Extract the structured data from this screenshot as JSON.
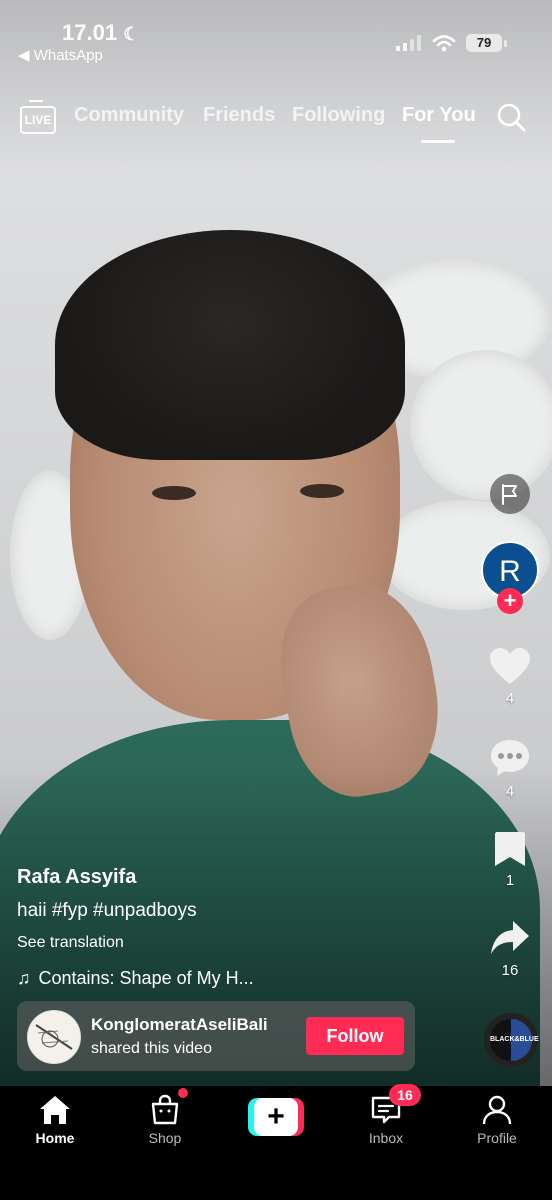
{
  "status_bar": {
    "time": "17.01",
    "back_app": "◀ WhatsApp",
    "battery": "79"
  },
  "top_nav": {
    "live_label": "LIVE",
    "tabs": [
      {
        "label": "Community",
        "active": false
      },
      {
        "label": "Friends",
        "active": false
      },
      {
        "label": "Following",
        "active": false
      },
      {
        "label": "For You",
        "active": true
      }
    ]
  },
  "right_rail": {
    "avatar_initial": "R",
    "likes": "4",
    "comments": "4",
    "saves": "1",
    "shares": "16",
    "music_disc_text": "BLACK&BLUE"
  },
  "post": {
    "username": "Rafa Assyifa",
    "caption": "haii #fyp #unpadboys",
    "see_translation": "See translation",
    "music": "Contains: Shape of My H..."
  },
  "share_card": {
    "name": "KonglomeratAseliBali",
    "subtitle": "shared this video",
    "follow_label": "Follow"
  },
  "bottom_nav": {
    "items": [
      {
        "label": "Home",
        "active": true
      },
      {
        "label": "Shop",
        "active": false
      },
      {
        "label": "Inbox",
        "active": false
      },
      {
        "label": "Profile",
        "active": false
      }
    ],
    "inbox_badge": "16"
  },
  "colors": {
    "accent": "#fe2c55",
    "cyan": "#25f4ee",
    "avatar_bg": "#0c4f91"
  }
}
